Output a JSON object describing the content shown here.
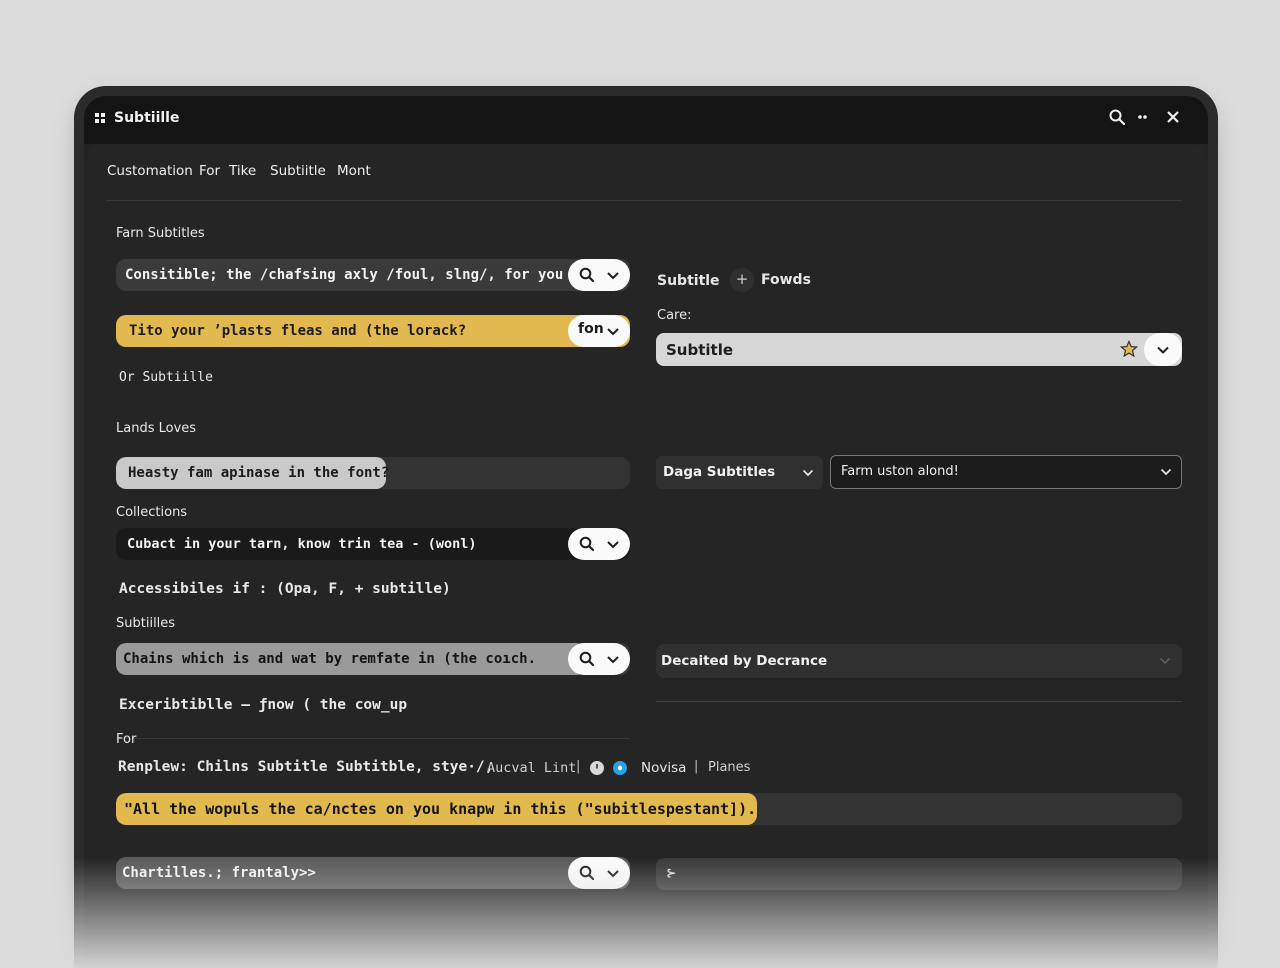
{
  "window": {
    "title": "Subtiille"
  },
  "tabs": [
    "Customation",
    "For",
    "Tike",
    "Subtiitle",
    "Mont"
  ],
  "left": {
    "section1_label": "Farn Subtitles",
    "row1_text": "Consitible; the /chafsing axly /foul, slng/, for you",
    "row2_text": "Tito your ’plasts fleas and (the lorack?",
    "row2_pill": "fon",
    "or_subtitle": "Or Subtiille",
    "section2_label": "Lands Loves",
    "row3_text": "Heasty fam apinase in the font?",
    "collections_label": "Collections",
    "row4_text": "Cubact in your tarn, know trin tea - (wonl)",
    "accessibles_line": "Accessibiles   if : (Opa,   F, +  subtille)",
    "subtiilles_label": "Subtiilles",
    "row5_text": "Chains which is and wat by remfate in (the coıch.",
    "exceribtible_line": "Exceribtiblle — ƒnow (  the cow_up",
    "for_label": "For"
  },
  "right": {
    "subtitle_label": "Subtitle",
    "fowds_label": "Fowds",
    "care_label": "Care:",
    "care_select_value": "Subtitle",
    "daga_select": "Daga Subtitles",
    "farm_select": "Farm uston alond!",
    "decaited_select": "Decaited by Decrance",
    "bottom_select_glyph": "⊱"
  },
  "footer": {
    "renplew_line": "Renplew: Chilns Subtitle Subtitble, stye·/,",
    "aucval": "Aucval Lint",
    "novisa": "Novisa",
    "planes": "Planes",
    "quote_bar": "\"All the wopuls the ca/nctes on you knapw in this (\"subitlespestant]).",
    "chartilles": "Chartilles.; frantaly>>"
  },
  "colors": {
    "accent_yellow": "#e2b94e",
    "bar_gray": "#c9c9c9",
    "bar_dark": "#1a1a1a",
    "pill_white": "#fafafa",
    "info_blue": "#29a3e6"
  },
  "icons": [
    "grid-icon",
    "search-icon",
    "more-icon",
    "close-icon",
    "chevron-down-icon",
    "star-icon",
    "plus-icon",
    "clock-icon",
    "info-icon"
  ]
}
